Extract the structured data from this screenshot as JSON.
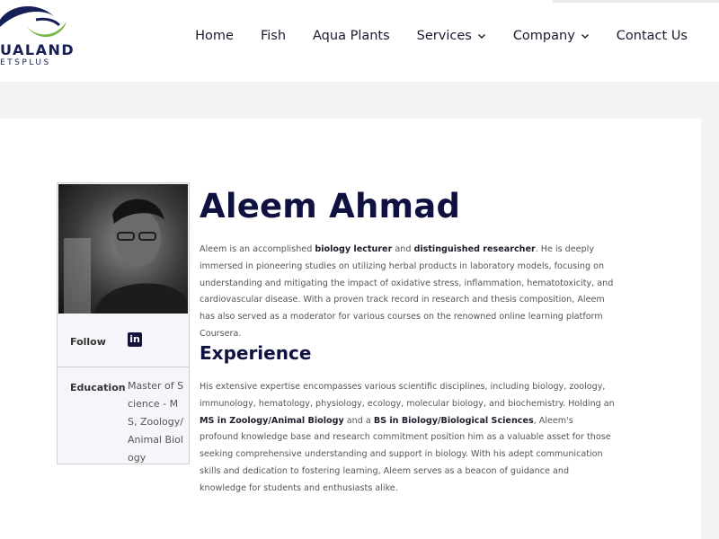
{
  "header": {
    "logo_word": "UALAND",
    "logo_sub": "ETSPLUS",
    "nav": [
      {
        "label": "Home"
      },
      {
        "label": "Fish"
      },
      {
        "label": "Aqua Plants"
      },
      {
        "label": "Services"
      },
      {
        "label": "Company"
      },
      {
        "label": "Contact Us"
      }
    ]
  },
  "profile": {
    "follow_label": "Follow",
    "linkedin_icon": "linkedin-icon",
    "linkedin_glyph": "in",
    "education_label": "Education",
    "education_value": "Master of Science - MS, Zoology/Animal Biology"
  },
  "main": {
    "name": "Aleem Ahmad",
    "bio": {
      "t1": "Aleem is an accomplished ",
      "b1": "biology lecturer",
      "t2": " and ",
      "b2": "distinguished researcher",
      "t3": ". He is deeply immersed in pioneering studies on utilizing herbal products in laboratory models, focusing on understanding and mitigating the impact of oxidative stress, inflammation, hematotoxicity, and cardiovascular disease. With a proven track record in research and thesis composition, Aleem has also served as a moderator for various courses on the renowned online learning platform Coursera."
    },
    "experience_heading": "Experience",
    "experience": {
      "t1": "His extensive expertise encompasses various scientific disciplines, including biology, zoology, immunology, hematology, physiology, ecology, molecular biology, and biochemistry. Holding an ",
      "b1": "MS in Zoology/Animal Biology",
      "t2": " and a ",
      "b2": "BS in Biology/Biological Sciences",
      "t3": ", Aleem's profound knowledge base and research commitment position him as a valuable asset for those seeking comprehensive understanding and support in biology. With his adept communication skills and dedication to fostering learning, Aleem serves as a beacon of guidance and knowledge for students and enthusiasts alike."
    }
  },
  "colors": {
    "brand_navy": "#0f1240",
    "logo_blue": "#162056",
    "logo_green": "#7ab648",
    "page_bg": "#f3f3f3"
  }
}
